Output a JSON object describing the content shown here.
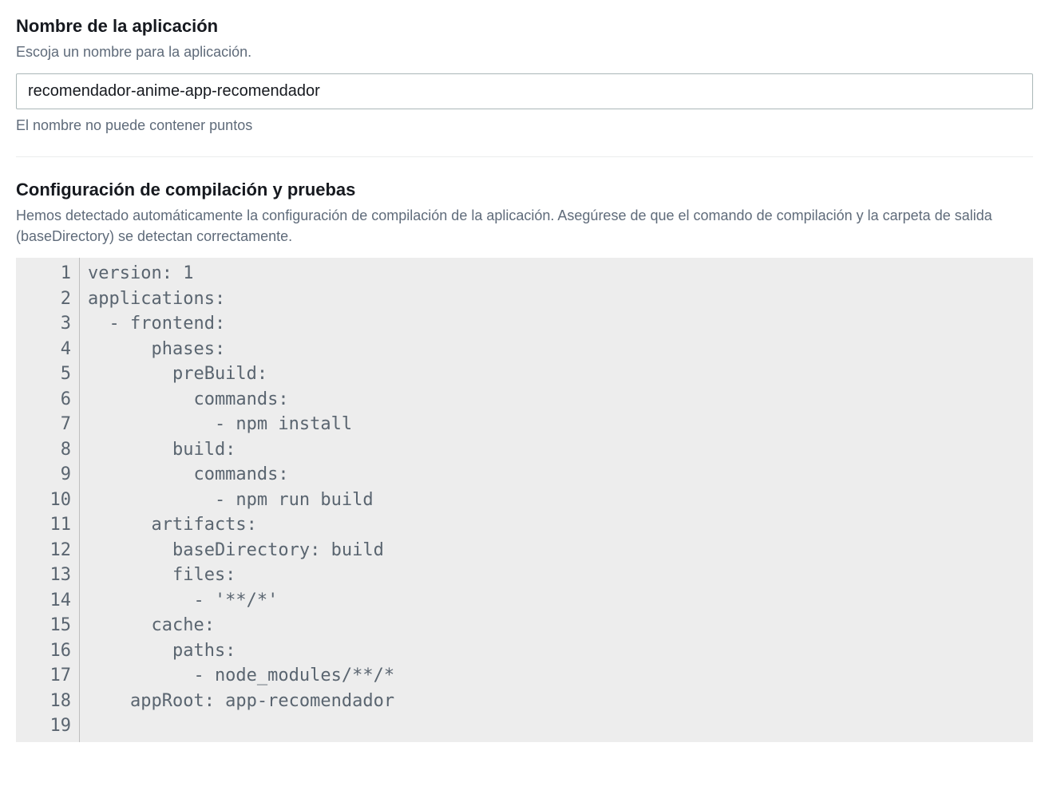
{
  "appName": {
    "title": "Nombre de la aplicación",
    "subtitle": "Escoja un nombre para la aplicación.",
    "value": "recomendador-anime-app-recomendador",
    "helper": "El nombre no puede contener puntos"
  },
  "buildConfig": {
    "title": "Configuración de compilación y pruebas",
    "subtitle": "Hemos detectado automáticamente la configuración de compilación de la aplicación. Asegúrese de que el comando de compilación y la carpeta de salida (baseDirectory) se detectan correctamente.",
    "code": "version: 1\napplications:\n  - frontend:\n      phases:\n        preBuild:\n          commands:\n            - npm install\n        build:\n          commands:\n            - npm run build\n      artifacts:\n        baseDirectory: build\n        files:\n          - '**/*'\n      cache:\n        paths:\n          - node_modules/**/*\n    appRoot: app-recomendador\n"
  }
}
